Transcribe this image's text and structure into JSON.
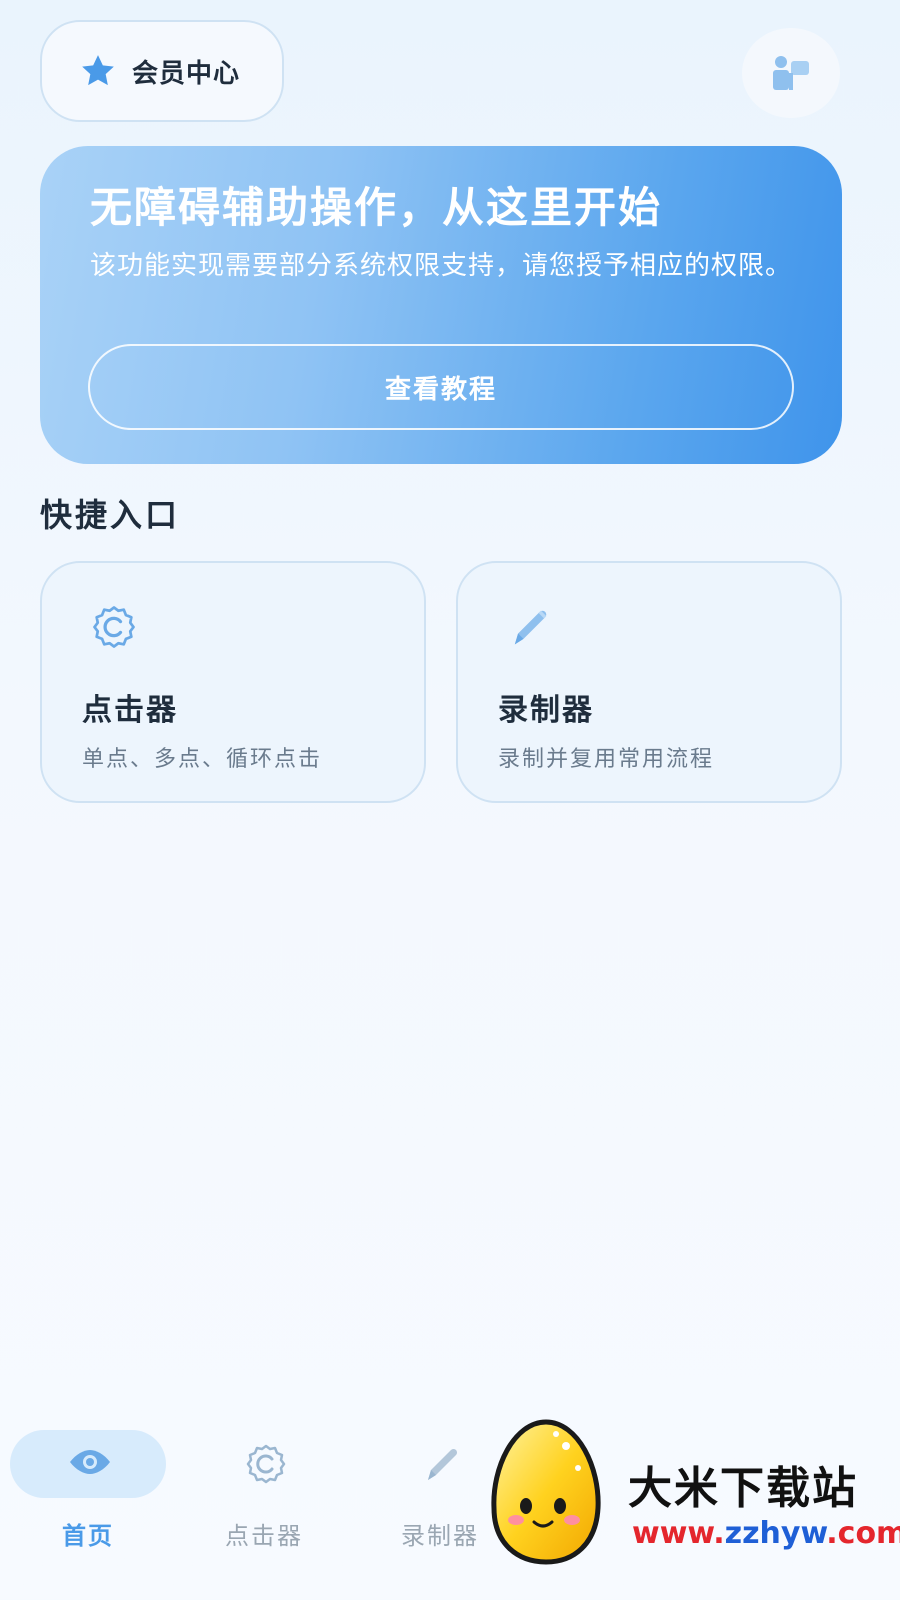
{
  "header": {
    "member_label": "会员中心",
    "member_icon": "star-icon",
    "service_icon": "customer-service-icon"
  },
  "hero": {
    "title": "无障碍辅助操作，从这里开始",
    "description": "该功能实现需要部分系统权限支持，请您授予相应的权限。",
    "button_label": "查看教程"
  },
  "quick_entry": {
    "title": "快捷入口",
    "cards": [
      {
        "icon": "gear-icon",
        "title": "点击器",
        "subtitle": "单点、多点、循环点击"
      },
      {
        "icon": "pencil-icon",
        "title": "录制器",
        "subtitle": "录制并复用常用流程"
      }
    ]
  },
  "bottom_nav": {
    "items": [
      {
        "icon": "eye-icon",
        "label": "首页",
        "active": true
      },
      {
        "icon": "gear-icon",
        "label": "点击器",
        "active": false
      },
      {
        "icon": "pencil-icon",
        "label": "录制器",
        "active": false
      }
    ]
  },
  "watermark": {
    "title": "大米下载站",
    "url_parts": [
      "www.",
      "zzhyw",
      ".com"
    ],
    "mascot": "egg-mascot-logo"
  },
  "colors": {
    "accent": "#4a9ae8",
    "hero_start": "#a9d2f7",
    "hero_end": "#3f94eb",
    "icon_blue": "#7fb4e8"
  }
}
